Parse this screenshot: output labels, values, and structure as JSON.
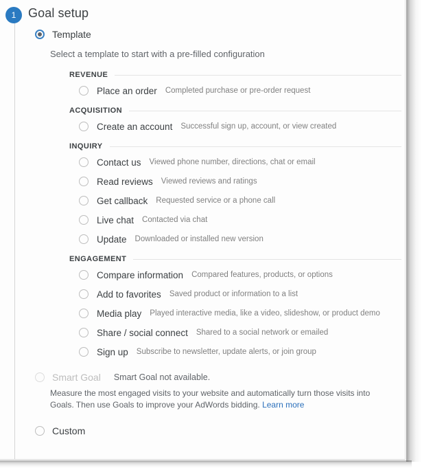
{
  "header": {
    "step_number": "1",
    "title": "Goal setup"
  },
  "template_option": {
    "label": "Template",
    "selected": true,
    "helper_text": "Select a template to start with a pre-filled configuration"
  },
  "groups": [
    {
      "name": "REVENUE",
      "options": [
        {
          "label": "Place an order",
          "description": "Completed purchase or pre-order request"
        }
      ]
    },
    {
      "name": "ACQUISITION",
      "options": [
        {
          "label": "Create an account",
          "description": "Successful sign up, account, or view created"
        }
      ]
    },
    {
      "name": "INQUIRY",
      "options": [
        {
          "label": "Contact us",
          "description": "Viewed phone number, directions, chat or email"
        },
        {
          "label": "Read reviews",
          "description": "Viewed reviews and ratings"
        },
        {
          "label": "Get callback",
          "description": "Requested service or a phone call"
        },
        {
          "label": "Live chat",
          "description": "Contacted via chat"
        },
        {
          "label": "Update",
          "description": "Downloaded or installed new version"
        }
      ]
    },
    {
      "name": "ENGAGEMENT",
      "options": [
        {
          "label": "Compare information",
          "description": "Compared features, products, or options"
        },
        {
          "label": "Add to favorites",
          "description": "Saved product or information to a list"
        },
        {
          "label": "Media play",
          "description": "Played interactive media, like a video, slideshow, or product demo"
        },
        {
          "label": "Share / social connect",
          "description": "Shared to a social network or emailed"
        },
        {
          "label": "Sign up",
          "description": "Subscribe to newsletter, update alerts, or join group"
        }
      ]
    }
  ],
  "smart_goal": {
    "label": "Smart Goal",
    "status": "Smart Goal not available.",
    "description": "Measure the most engaged visits to your website and automatically turn those visits into Goals. Then use Goals to improve your AdWords bidding.",
    "link_text": "Learn more",
    "disabled": true
  },
  "custom_option": {
    "label": "Custom",
    "selected": false
  },
  "colors": {
    "accent": "#2a7ac1",
    "radio_selected_ring": "#3b82c4",
    "link": "#2a6fbb",
    "text_primary": "#3c4043",
    "text_secondary": "#5f6368",
    "text_muted": "#808080",
    "disabled": "#bdbdbd",
    "rule": "#e4e4e4"
  }
}
